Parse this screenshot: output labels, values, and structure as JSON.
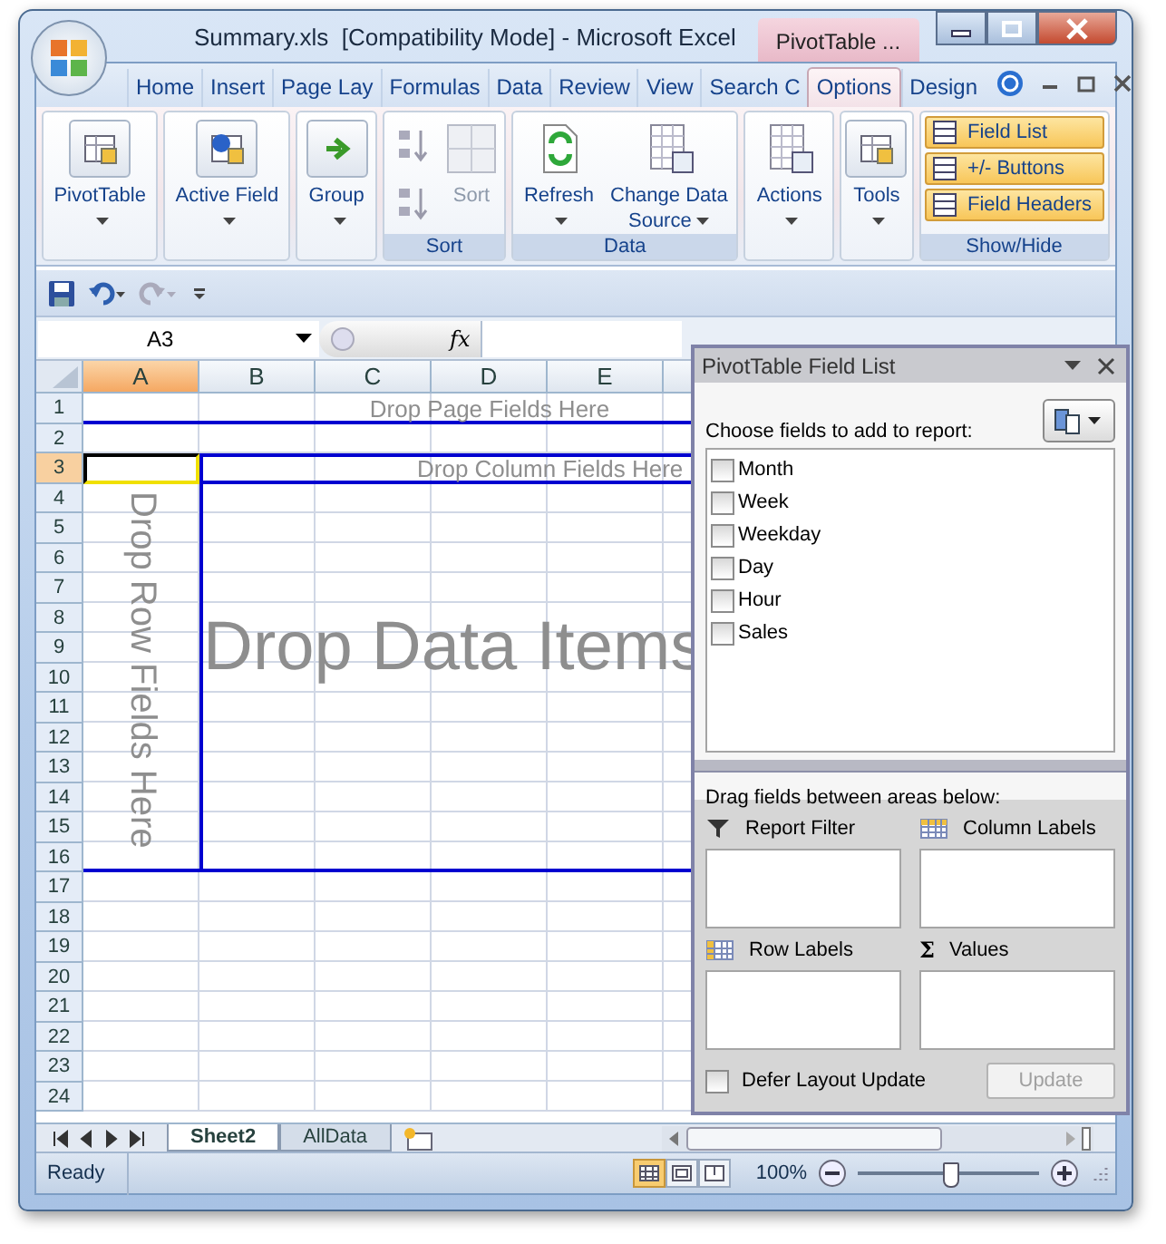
{
  "window": {
    "title": "Summary.xls  [Compatibility Mode] - Microsoft Excel",
    "context_tab": "PivotTable ..."
  },
  "ribbon_tabs": [
    {
      "label": "Home",
      "selected": false
    },
    {
      "label": "Insert",
      "selected": false
    },
    {
      "label": "Page Lay",
      "selected": false
    },
    {
      "label": "Formulas",
      "selected": false
    },
    {
      "label": "Data",
      "selected": false
    },
    {
      "label": "Review",
      "selected": false
    },
    {
      "label": "View",
      "selected": false
    },
    {
      "label": "Search C",
      "selected": false
    },
    {
      "label": "Options",
      "selected": true
    },
    {
      "label": "Design",
      "selected": false
    }
  ],
  "ribbon_groups": [
    {
      "kind": "large",
      "buttons": [
        {
          "label": "PivotTable",
          "dropdown": true
        }
      ]
    },
    {
      "kind": "large",
      "buttons": [
        {
          "label": "Active Field",
          "dropdown": true
        }
      ]
    },
    {
      "kind": "large",
      "buttons": [
        {
          "label": "Group",
          "dropdown": true
        }
      ]
    },
    {
      "kind": "sort",
      "label": "Sort",
      "buttons": [
        {
          "label": "Sort",
          "disabled": true
        }
      ]
    },
    {
      "kind": "large",
      "label": "Data",
      "buttons": [
        {
          "label": "Refresh",
          "dropdown": true
        },
        {
          "label": "Change Data Source",
          "dropdown": true
        }
      ]
    },
    {
      "kind": "large",
      "buttons": [
        {
          "label": "Actions",
          "dropdown": true
        }
      ]
    },
    {
      "kind": "large",
      "buttons": [
        {
          "label": "Tools",
          "dropdown": true
        }
      ]
    },
    {
      "kind": "toggles",
      "label": "Show/Hide",
      "buttons": [
        {
          "label": "Field List",
          "on": true
        },
        {
          "label": "+/- Buttons",
          "on": true
        },
        {
          "label": "Field Headers",
          "on": true
        }
      ]
    }
  ],
  "formula_bar": {
    "name_box": "A3",
    "function_label": "fx"
  },
  "sheet": {
    "columns": [
      {
        "label": "A",
        "selected": true
      },
      {
        "label": "B",
        "selected": false
      },
      {
        "label": "C",
        "selected": false
      },
      {
        "label": "D",
        "selected": false
      },
      {
        "label": "E",
        "selected": false
      }
    ],
    "rows": [
      {
        "label": "1",
        "selected": false
      },
      {
        "label": "2",
        "selected": false
      },
      {
        "label": "3",
        "selected": true
      },
      {
        "label": "4",
        "selected": false
      },
      {
        "label": "5",
        "selected": false
      },
      {
        "label": "6",
        "selected": false
      },
      {
        "label": "7",
        "selected": false
      },
      {
        "label": "8",
        "selected": false
      },
      {
        "label": "9",
        "selected": false
      },
      {
        "label": "10",
        "selected": false
      },
      {
        "label": "11",
        "selected": false
      },
      {
        "label": "12",
        "selected": false
      },
      {
        "label": "13",
        "selected": false
      },
      {
        "label": "14",
        "selected": false
      },
      {
        "label": "15",
        "selected": false
      },
      {
        "label": "16",
        "selected": false
      },
      {
        "label": "17",
        "selected": false
      },
      {
        "label": "18",
        "selected": false
      },
      {
        "label": "19",
        "selected": false
      },
      {
        "label": "20",
        "selected": false
      },
      {
        "label": "21",
        "selected": false
      },
      {
        "label": "22",
        "selected": false
      },
      {
        "label": "23",
        "selected": false
      },
      {
        "label": "24",
        "selected": false
      }
    ],
    "pivot_area": {
      "page_hint": "Drop Page Fields Here",
      "column_hint": "Drop Column Fields Here",
      "row_hint": "Drop Row Fields Here",
      "data_hint": "Drop Data Items"
    }
  },
  "sheet_tabs": [
    {
      "label": "Sheet2",
      "selected": true
    },
    {
      "label": "AllData",
      "selected": false
    }
  ],
  "status_bar": {
    "status": "Ready",
    "views": [
      {
        "selected": true
      },
      {
        "selected": false
      },
      {
        "selected": false
      }
    ],
    "zoom": {
      "reading": "100%",
      "level": 0.5
    }
  },
  "field_list": {
    "title": "PivotTable Field List",
    "prompt": "Choose fields to add to report:",
    "fields": [
      {
        "label": "Month",
        "checked": false
      },
      {
        "label": "Week",
        "checked": false
      },
      {
        "label": "Weekday",
        "checked": false
      },
      {
        "label": "Day",
        "checked": false
      },
      {
        "label": "Hour",
        "checked": false
      },
      {
        "label": "Sales",
        "checked": false
      }
    ],
    "areas_prompt": "Drag fields between areas below:",
    "areas": [
      {
        "kind": "filter",
        "label": "Report Filter"
      },
      {
        "kind": "columns",
        "label": "Column Labels"
      },
      {
        "kind": "rows",
        "label": "Row Labels"
      },
      {
        "kind": "values",
        "label": "Values",
        "symbol": "Σ"
      }
    ],
    "defer": {
      "label": "Defer Layout Update",
      "checked": false
    },
    "update": {
      "label": "Update",
      "disabled": true
    }
  }
}
